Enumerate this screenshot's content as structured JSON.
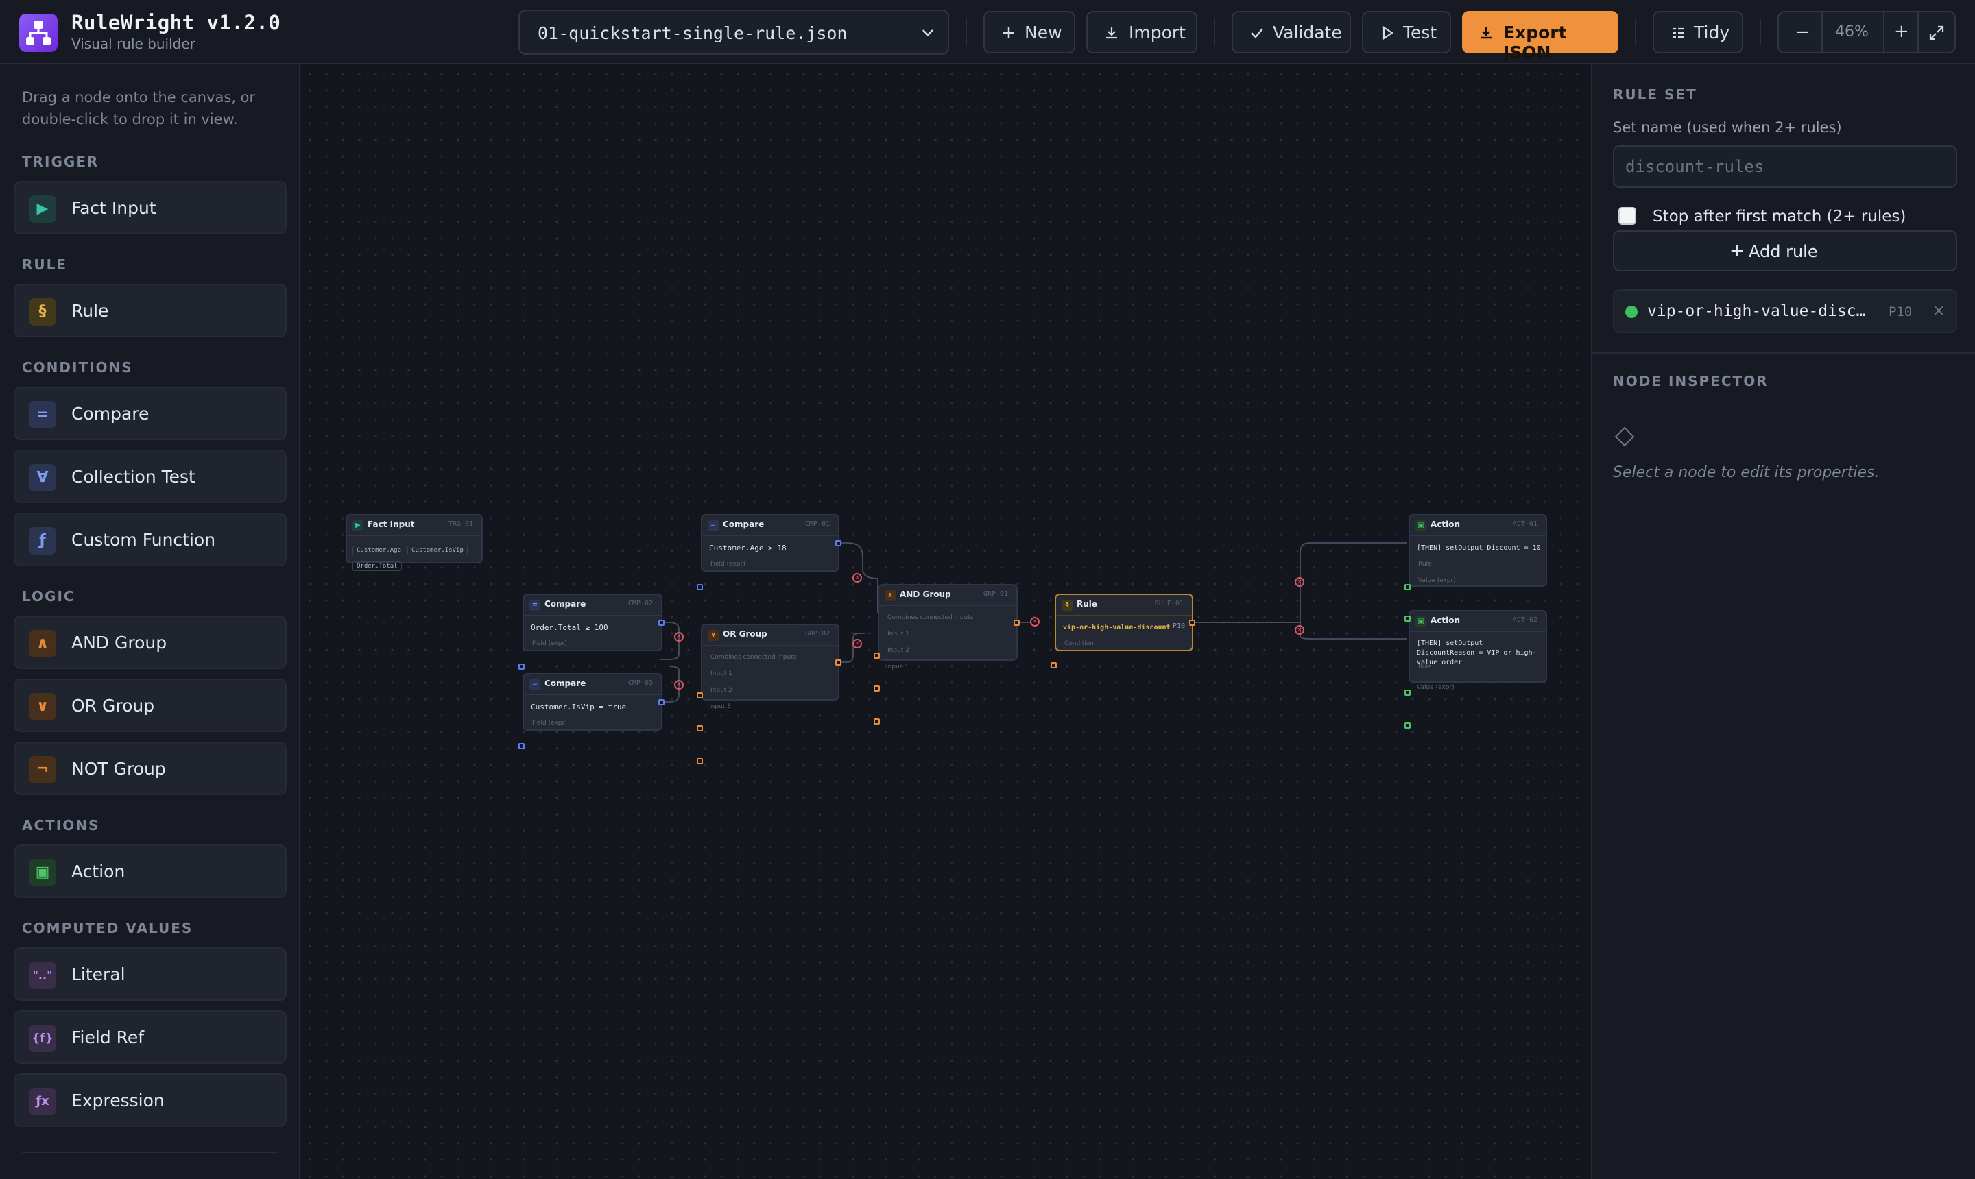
{
  "app": {
    "title": "RuleWright v1.2.0",
    "subtitle": "Visual rule builder"
  },
  "toolbar": {
    "file_selected": "01-quickstart-single-rule.json",
    "new_label": "New",
    "import_label": "Import",
    "validate_label": "Validate",
    "test_label": "Test",
    "export_label": "Export JSON",
    "tidy_label": "Tidy",
    "zoom_out": "−",
    "zoom_level": "46%",
    "zoom_in": "+",
    "accent_color": "#f0913e"
  },
  "sidebar": {
    "hint": "Drag a node onto the canvas, or double-click to drop it in view.",
    "sections": {
      "trigger": "TRIGGER",
      "rule": "RULE",
      "conditions": "CONDITIONS",
      "logic": "LOGIC",
      "actions": "ACTIONS",
      "computed": "COMPUTED VALUES"
    },
    "items": {
      "fact_input": {
        "label": "Fact Input",
        "icon": "▶"
      },
      "rule": {
        "label": "Rule",
        "icon": "§"
      },
      "compare": {
        "label": "Compare",
        "icon": "="
      },
      "collection_test": {
        "label": "Collection Test",
        "icon": "∀"
      },
      "custom_function": {
        "label": "Custom Function",
        "icon": "ƒ"
      },
      "and_group": {
        "label": "AND Group",
        "icon": "∧"
      },
      "or_group": {
        "label": "OR Group",
        "icon": "∨"
      },
      "not_group": {
        "label": "NOT Group",
        "icon": "¬"
      },
      "action": {
        "label": "Action",
        "icon": "▣"
      },
      "literal": {
        "label": "Literal",
        "icon": "\"..\""
      },
      "field_ref": {
        "label": "Field Ref",
        "icon": "{f}"
      },
      "expression": {
        "label": "Expression",
        "icon": "ƒx"
      }
    }
  },
  "canvas": {
    "nodes": {
      "fact": {
        "title": "Fact Input",
        "id": "TRG-01",
        "chips": [
          "Customer.Age",
          "Customer.IsVip",
          "Order.Total"
        ]
      },
      "cmp1": {
        "title": "Compare",
        "id": "CMP-01",
        "body": "Customer.Age > 18",
        "port": "Field (expr)"
      },
      "cmp2": {
        "title": "Compare",
        "id": "CMP-02",
        "body": "Order.Total ≥ 100",
        "port": "Field (expr)"
      },
      "cmp3": {
        "title": "Compare",
        "id": "CMP-03",
        "body": "Customer.IsVip = true",
        "port": "Field (expr)"
      },
      "or": {
        "title": "OR Group",
        "id": "GRP-02",
        "desc": "Combines connected inputs",
        "in1": "Input 1",
        "in2": "Input 2",
        "in3": "Input 3"
      },
      "and": {
        "title": "AND Group",
        "id": "GRP-01",
        "desc": "Combines connected inputs",
        "in1": "Input 1",
        "in2": "Input 2",
        "in3": "Input 3"
      },
      "rule": {
        "title": "Rule",
        "id": "RULE-01",
        "body": "vip-or-high-value-discount",
        "prio": "P10",
        "port": "Condition"
      },
      "act1": {
        "title": "Action",
        "id": "ACT-01",
        "body": "[THEN] setOutput Discount = 10",
        "port1": "Rule",
        "port2": "Value (expr)"
      },
      "act2": {
        "title": "Action",
        "id": "ACT-02",
        "body": "[THEN] setOutput DiscountReason = VIP or high-value order",
        "port1": "Rule",
        "port2": "Value (expr)"
      }
    }
  },
  "rule_set": {
    "title": "RULE SET",
    "set_name_label": "Set name (used when 2+ rules)",
    "set_name_placeholder": "discount-rules",
    "stop_label": "Stop after first match (2+ rules)",
    "add_rule_label": "Add rule",
    "rules": [
      {
        "name": "vip-or-high-value-discount",
        "priority": "P10",
        "status_color": "#3fbf61"
      }
    ]
  },
  "inspector": {
    "title": "NODE INSPECTOR",
    "empty_text": "Select a node to edit its properties."
  }
}
